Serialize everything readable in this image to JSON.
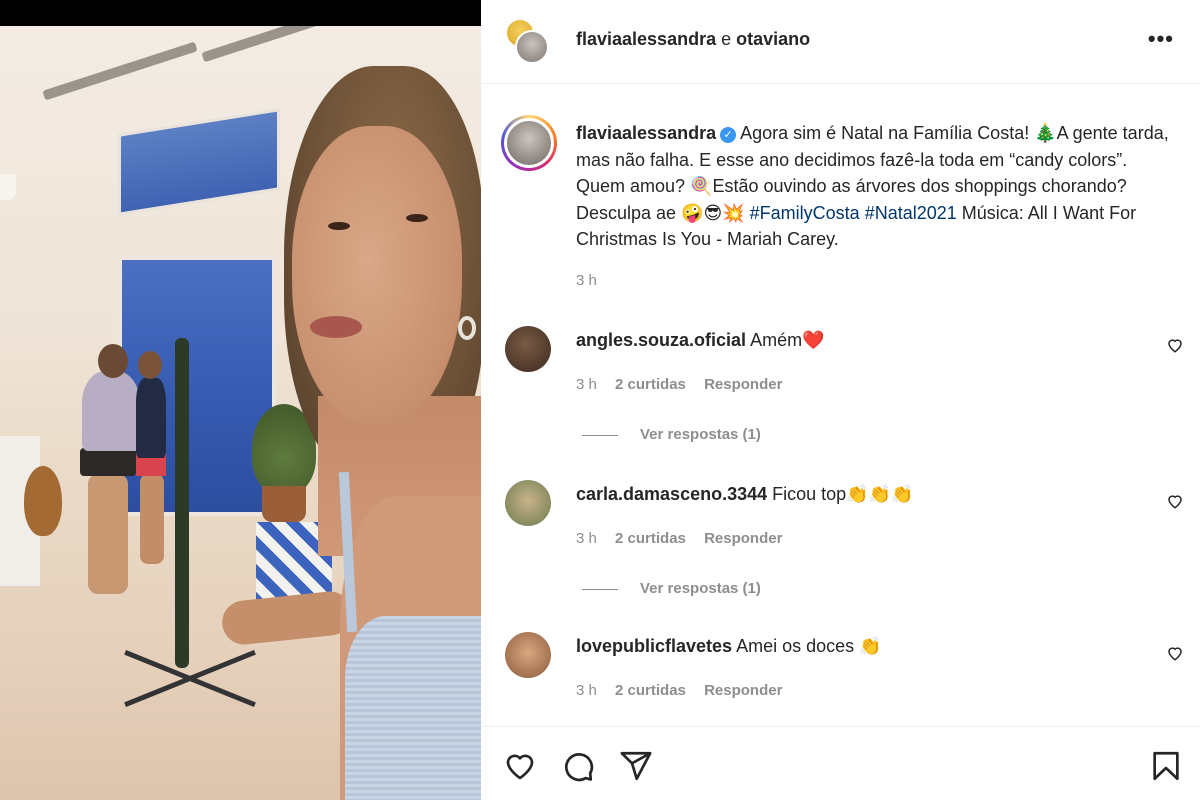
{
  "header": {
    "user1": "flaviaalessandra",
    "conjunction": "e",
    "user2": "otaviano",
    "more_label": "•••"
  },
  "caption": {
    "username": "flaviaalessandra",
    "text_part1": "Agora sim é Natal na Família Costa! 🎄A gente tarda, mas não falha. E esse ano decidimos fazê-la toda em “candy colors”. Quem amou? 🍭Estão ouvindo as árvores dos shoppings chorando? Desculpa ae 🤪😎💥 ",
    "hashtag1": "#FamilyCosta",
    "hashtag2": "#Natal2021",
    "text_part2": " Música: All I Want For Christmas Is You - Mariah Carey.",
    "time": "3 h"
  },
  "comments": [
    {
      "username": "angles.souza.oficial",
      "text": "Amém❤️",
      "time": "3 h",
      "likes": "2 curtidas",
      "reply": "Responder",
      "view_replies": "Ver respostas (1)"
    },
    {
      "username": "carla.damasceno.3344",
      "text": "Ficou top👏👏👏",
      "time": "3 h",
      "likes": "2 curtidas",
      "reply": "Responder",
      "view_replies": "Ver respostas (1)"
    },
    {
      "username": "lovepublicflavetes",
      "text": "Amei os doces 👏",
      "time": "3 h",
      "likes": "2 curtidas",
      "reply": "Responder"
    }
  ],
  "colors": {
    "accent_blue": "#3897f0",
    "hashtag": "#00376b",
    "muted": "#8e8e8e"
  },
  "icons": [
    "heart-icon",
    "comment-icon",
    "share-icon",
    "bookmark-icon",
    "verified-icon",
    "more-icon"
  ]
}
